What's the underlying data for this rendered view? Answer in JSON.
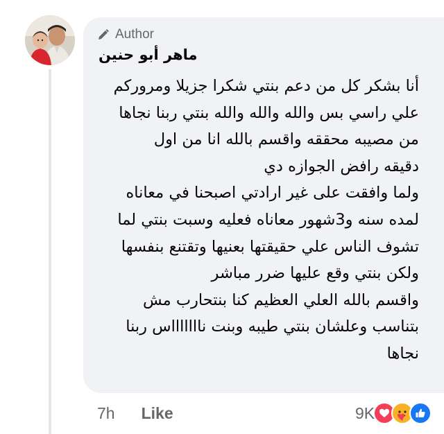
{
  "comment": {
    "badge_label": "Author",
    "author_name": "ماهر أبو حنين",
    "lines": [
      "أنا بشكر كل من دعم بنتي شكرا جزيلا ومروركم",
      "علي راسي بس والله والله والله بنتي ربنا نجاها",
      "من مصيبه محققه واقسم بالله انا من اول",
      "دقيقه رافض الجوازه دي",
      "ولما وافقت على غير ارادتي اصبحنا في معاناه",
      "لمده سنه و3شهور معاناه فعليه وسبت بنتي لما",
      "تشوف الناس علي حقيقتها بعنيها وتقتنع بنفسها",
      "ولكن بنتي وقع عليها ضرر مباشر",
      "واقسم بالله العلي العظيم كنا بنتحارب مش",
      "بتناسب وعلشان بنتي طيبه وبنت ناااااااس ربنا",
      "نجاها"
    ]
  },
  "actions": {
    "time": "7h",
    "like_label": "Like"
  },
  "reactions": {
    "count": "9K",
    "icons": [
      "heart-icon",
      "care-icon",
      "like-icon"
    ]
  },
  "colors": {
    "bubble": "#f0f2f5",
    "meta_text": "#65676b",
    "heart": "#f33e58",
    "like": "#1877f2",
    "care": "#f7b125"
  }
}
